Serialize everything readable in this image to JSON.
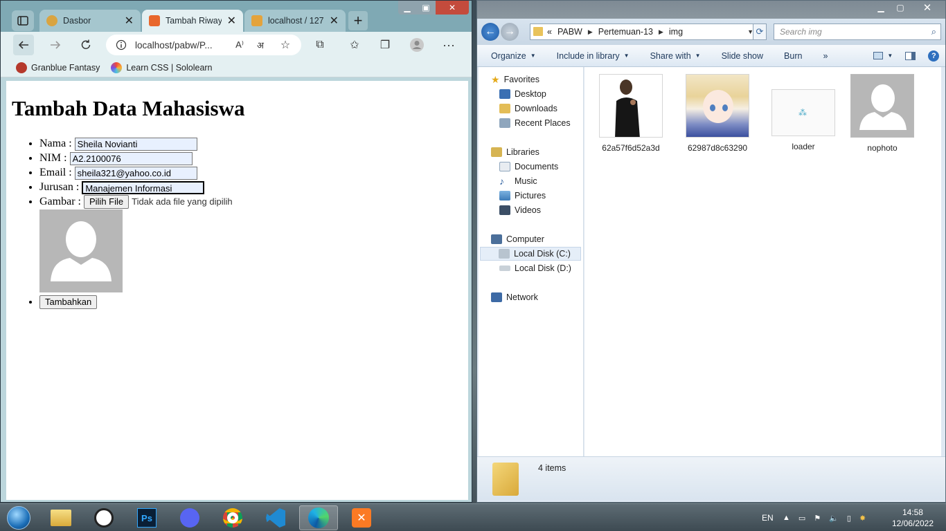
{
  "browser": {
    "tabs": [
      {
        "label": "Dasbor",
        "favicon_color": "#d9a441"
      },
      {
        "label": "Tambah Riwayat",
        "favicon_color": "#e8672c"
      },
      {
        "label": "localhost / 127",
        "favicon_color": "#e4a33c"
      }
    ],
    "new_tab": "+",
    "address": "localhost/pabw/P...",
    "bookmarks": [
      {
        "label": "Granblue Fantasy",
        "color": "#b5392c"
      },
      {
        "label": "Learn CSS | Sololearn",
        "color": "#7b4de3"
      }
    ]
  },
  "form": {
    "title": "Tambah Data Mahasiswa",
    "nama_label": "Nama :",
    "nama_value": "Sheila Novianti",
    "nim_label": "NIM :",
    "nim_value": "A2.2100076",
    "email_label": "Email :",
    "email_value": "sheila321@yahoo.co.id",
    "jurusan_label": "Jurusan :",
    "jurusan_value": "Manajemen Informasi",
    "gambar_label": "Gambar :",
    "file_button": "Pilih File",
    "file_status": "Tidak ada file yang dipilih",
    "submit": "Tambahkan"
  },
  "explorer": {
    "path": [
      "«",
      "PABW",
      "Pertemuan-13",
      "img"
    ],
    "search_placeholder": "Search img",
    "commands": [
      {
        "label": "Organize",
        "caret": true
      },
      {
        "label": "Include in library",
        "caret": true
      },
      {
        "label": "Share with",
        "caret": true
      },
      {
        "label": "Slide show",
        "caret": false
      },
      {
        "label": "Burn",
        "caret": false
      },
      {
        "label": "»",
        "caret": false
      }
    ],
    "nav": {
      "favorites": "Favorites",
      "desktop": "Desktop",
      "downloads": "Downloads",
      "recent": "Recent Places",
      "libraries": "Libraries",
      "documents": "Documents",
      "music": "Music",
      "pictures": "Pictures",
      "videos": "Videos",
      "computer": "Computer",
      "disk_c": "Local Disk (C:)",
      "disk_d": "Local Disk (D:)",
      "network": "Network"
    },
    "files": [
      {
        "name": "62a57f6d52a3d"
      },
      {
        "name": "62987d8c63290"
      },
      {
        "name": "loader"
      },
      {
        "name": "nophoto"
      }
    ],
    "item_count": "4 items"
  },
  "taskbar": {
    "language": "EN",
    "time": "14:58",
    "date": "12/06/2022"
  }
}
